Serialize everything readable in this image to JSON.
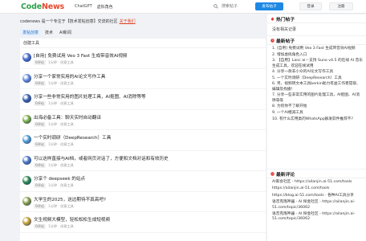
{
  "header": {
    "logo_part1": "Code",
    "logo_part2": "News",
    "nav": [
      "ChatGPT",
      "虚拟角色"
    ],
    "search_placeholder": "搜索帖子",
    "publish_label": "发布帖子",
    "login_label": "登录",
    "register_label": "注册"
  },
  "notice": {
    "text": "codenews 是一个专注于【技术发帖创意】交流的社区",
    "link": "关于我们"
  },
  "tabs": [
    "发帖创意",
    "技术",
    "AI新闻"
  ],
  "feed": {
    "title": "创建工具",
    "posts": [
      {
        "title": "[自用] 免费试用 Veo 3 Fast 生成带音效AI视频",
        "badge": "0评论",
        "meta": "1分钟 · 创意工具"
      },
      {
        "title": "分享一个家常实用的AI论文写作工具",
        "badge": "0评论",
        "meta": "1分钟 · 创意工具"
      },
      {
        "title": "分享一些非常实用的图片处理工具，AI抠图、AI消除等等",
        "badge": "0评论",
        "meta": "1分钟 · 创意工具"
      },
      {
        "title": "出海必备工具：聊天实时自动翻译",
        "badge": "0评论",
        "meta": "1分钟 · 创意工具"
      },
      {
        "title": "一个实时调研（DeepResearch）工具",
        "badge": "0评论",
        "meta": "1分钟 · 创意工具"
      },
      {
        "title": "可以这样直接与AI档，或者网页对话了，方便和文档对话和有效历史",
        "badge": "0评论",
        "meta": "1分钟 · 创意工具"
      },
      {
        "title": "分享个 deepseek 的站点",
        "badge": "0评论",
        "meta": "1分钟 · 创意工具"
      },
      {
        "title": "大学生的2025，这边期待不真高吧?",
        "badge": "0评论",
        "meta": "1分钟 · 创意工具"
      },
      {
        "title": "文生视频大模型，轻松松松生成短视频",
        "badge": "0评论",
        "meta": "1分钟 · 创意工具"
      }
    ]
  },
  "sidebar": {
    "hot_title": "热门帖子",
    "hot_empty": "没有相关记录",
    "recent_title": "最新帖子",
    "recent": [
      "1. [自用] 免费试用 Veo 3 Fast 生成带音效AI视频",
      "2. 增加虚拟角色入口",
      "3. 【自用】Lanc ai－支持 Suno v4.5 的在线 AI 音乐生成工具，欢迎在线试用",
      "4. 分享一款非小众的AI论文写作工具",
      "5. 一个实时调研（DeepResearch）工具",
      "6. 另，视频转文本工具berkin助力有益工作者提取、编辑及找播！",
      "7. 分享一些非常实用的图片处理工具，AI抠图、AI消除等等",
      "8. 为何你不了解开始",
      "9. 一个AI相减工具",
      "10. 有什么实用类的WhatsApp群发软件推荐不?"
    ],
    "comments_title": "最新评论",
    "comments": [
      "AI家会社区 - https://ailanjin.ai-51.com/tools",
      "https://ailanjin.ai-51.com/tools",
      "https://blog.ai-51.com/tools · 各种AI工具分享",
      "语音克隆神器 - AI 探金社区 - https://ailanjin.ai-51.com/topic/36062",
      "语音克隆神器 - AI 探金社区 - https://ailanjin.ai-51.com/topic/36062"
    ]
  },
  "colors": {
    "brand_green": "#2ea14c",
    "brand_red": "#e8472b",
    "primary": "#1e88e5",
    "accent_icon": "#e53935"
  },
  "avatar_colors": [
    "#4b6fd1",
    "#6a8fe0",
    "#3c64b0",
    "#7fb04a",
    "#55a0d8",
    "#4d7cc9",
    "#2f8b57",
    "#8aa34a",
    "#c9a43b"
  ]
}
